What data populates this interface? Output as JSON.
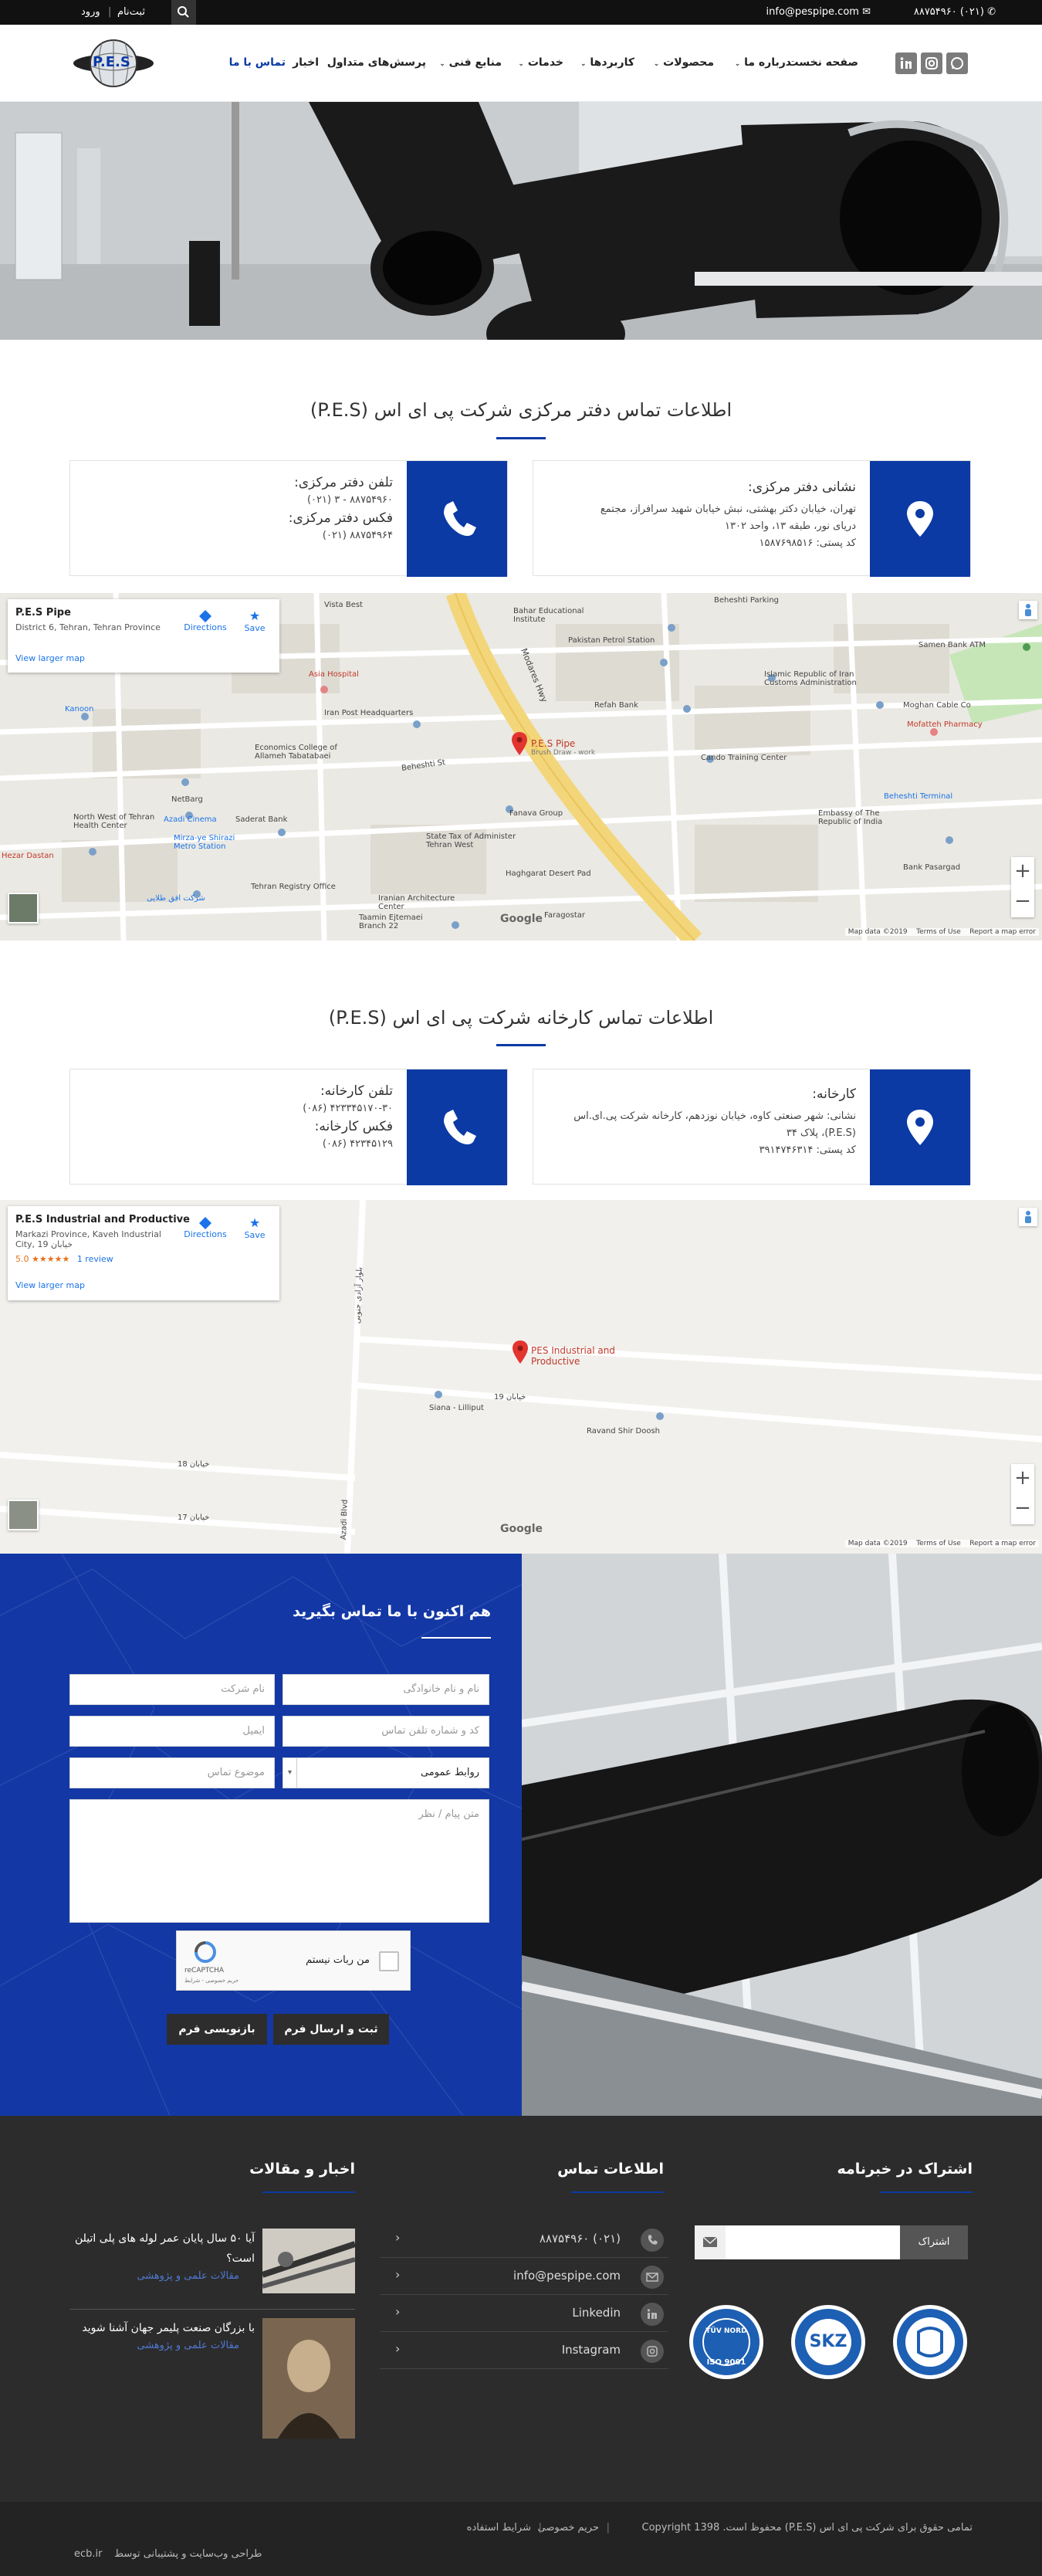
{
  "topbar": {
    "phone": "۸۸۷۵۴۹۶۰ (۰۲۱)",
    "email": "info@pespipe.com",
    "login": "ورود",
    "register": "ثبت‌نام"
  },
  "logo_text": "P.E.S",
  "nav": [
    {
      "label": "صفحه نخست",
      "dropdown": false
    },
    {
      "label": "درباره ما",
      "dropdown": true
    },
    {
      "label": "محصولات",
      "dropdown": true
    },
    {
      "label": "کاربردها",
      "dropdown": true
    },
    {
      "label": "خدمات",
      "dropdown": true
    },
    {
      "label": "منابع فنی",
      "dropdown": true
    },
    {
      "label": "پرسش‌های متداول",
      "dropdown": false
    },
    {
      "label": "اخبار",
      "dropdown": false
    },
    {
      "label": "تماس با ما",
      "dropdown": false,
      "active": true
    }
  ],
  "office": {
    "title": "اطلاعات تماس دفتر مرکزی شرکت پی ای اس (P.E.S)",
    "address_title": "نشانی دفتر مرکزی:",
    "address_lines": [
      "تهران، خیابان دکتر بهشتی، نبش خیابان شهید سرافراز، مجتمع",
      "دریای نور، طبقه ۱۳، واحد ۱۳۰۲",
      "کد پستی: ۱۵۸۷۶۹۸۵۱۶"
    ],
    "phone_title": "تلفن دفتر مرکزی:",
    "phone": "۸۸۷۵۴۹۶۰ - ۳ (۰۲۱)",
    "fax_title": "فکس دفتر مرکزی:",
    "fax": "۸۸۷۵۴۹۶۴ (۰۲۱)"
  },
  "map1": {
    "name": "P.E.S Pipe",
    "address": "District 6, Tehran, Tehran Province",
    "directions": "Directions",
    "save": "Save",
    "larger": "View larger map",
    "pin_label": "P.E.S Pipe",
    "pin_sub": "Brush Draw - work",
    "labels": [
      "Vista Best",
      "Bahar Educational Institute",
      "Pakistan Petrol Station",
      "Refah Bank",
      "Islamic Republic of Iran Customs Administration",
      "Moghan Cable Co",
      "Mofatteh Pharmacy",
      "Samen Bank ATM",
      "Asia Hospital",
      "Iran Post Headquarters",
      "Kanoon",
      "Economics College of Allameh Tabatabaei",
      "NetBarg",
      "Azadi Cinema",
      "Saderat Bank",
      "Mirza-ye Shirazi Metro Station",
      "Cando Training Center",
      "Fanava Group",
      "State Tax of Administer Tehran West",
      "Embassy of The Republic of India",
      "Beheshti Terminal",
      "Bank Pasargad",
      "Iranian Architecture Center",
      "Tehran Registry Office",
      "North West of Tehran Health Center",
      "Hezar Dastan",
      "Taamin Ejtemaei Branch 22",
      "Faragostar",
      "Haghgarat Desert Pad",
      "Beheshti Parking",
      "Modares Hwy",
      "Beheshti St",
      "شرکت افق طلایی"
    ],
    "footer": [
      "Map data ©2019",
      "Terms of Use",
      "Report a map error"
    ],
    "google": "Google"
  },
  "factory": {
    "title": "اطلاعات تماس کارخانه شرکت پی ای اس (P.E.S)",
    "address_title": "کارخانه:",
    "address_lines": [
      "نشانی: شهر صنعتی کاوه، خیابان نوزدهم، کارخانه شرکت پی.ای.اس",
      "(P.E.S)، پلاک ۳۴",
      "کد پستی: ۳۹۱۴۷۴۶۳۱۴"
    ],
    "phone_title": "تلفن کارخانه:",
    "phone": "۴۲۳۳۴۵۱۷۰-۳۰ (۰۸۶)",
    "fax_title": "فکس کارخانه:",
    "fax": "۴۲۳۴۵۱۲۹ (۰۸۶)"
  },
  "map2": {
    "name": "P.E.S Industrial and Productive",
    "address": "Markazi Province, Kaveh Industrial City, 19 خیابان",
    "rating": "5.0",
    "stars": "★★★★★",
    "reviews": "1 review",
    "directions": "Directions",
    "save": "Save",
    "larger": "View larger map",
    "pin_label": "PES Industrial and Productive",
    "labels": [
      "Siana - Lilliput",
      "Ravand Shir Doosh",
      "بلوار آزادی جنوبی",
      "خیابان 19",
      "خیابان 18",
      "خیابان 17",
      "Azadi Blvd"
    ],
    "footer": [
      "Map data ©2019",
      "Terms of Use",
      "Report a map error"
    ],
    "google": "Google"
  },
  "form": {
    "title": "هم اکنون با ما تماس بگیرید",
    "name": "نام و نام خانوادگی",
    "company": "نام شرکت",
    "phone": "کد و شماره تلفن تماس",
    "email": "ایمیل",
    "department": "روابط عمومی",
    "subject": "موضوع تماس",
    "message": "متن پیام / نظر",
    "captcha": "من ربات نیستم",
    "captcha_brand": "reCAPTCHA",
    "captcha_sub": "حریم خصوصی - شرایط",
    "submit": "ثبت و ارسال فرم",
    "reset": "بازنویسی فرم"
  },
  "footer": {
    "newsletter_title": "اشتراک در خبرنامه",
    "subscribe": "اشتراک",
    "contact_title": "اطلاعات تماس",
    "contact_rows": [
      {
        "icon": "phone-icon",
        "text": "۸۸۷۵۴۹۶۰ (۰۲۱)"
      },
      {
        "icon": "email-icon",
        "text": "info@pespipe.com"
      },
      {
        "icon": "linkedin-icon",
        "text": "Linkedin"
      },
      {
        "icon": "instagram-icon",
        "text": "Instagram"
      }
    ],
    "news_title": "اخبار و مقالات",
    "news": [
      {
        "title": "آیا ۵۰ سال پایان عمر لوله های پلی اتیلن است؟",
        "category": "مقالات علمی و پژوهشی"
      },
      {
        "title": "با بزرگان صنعت پلیمر جهان آشنا شوید",
        "category": "مقالات علمی و پژوهشی"
      }
    ],
    "certs": [
      "ISO 9001",
      "SKZ",
      "TUV NORD"
    ],
    "cert_iso": "ISO 9001",
    "cert_tuv": "TÜV NORD",
    "cert_skz": "SKZ",
    "copyright": "تمامی حقوق برای شرکت پی ای اس (P.E.S) محفوظ است. Copyright 1398",
    "privacy": "حریم خصوصی",
    "terms": "شرایط استفاده",
    "designer": "طراحی وب‌سایت و پشتیبانی توسط",
    "designer_brand": "ecb.ir"
  },
  "colors": {
    "accent": "#0b3aa5",
    "topbar": "#111111",
    "footer": "#2c2c2c",
    "form_bg": "#1338a5"
  }
}
